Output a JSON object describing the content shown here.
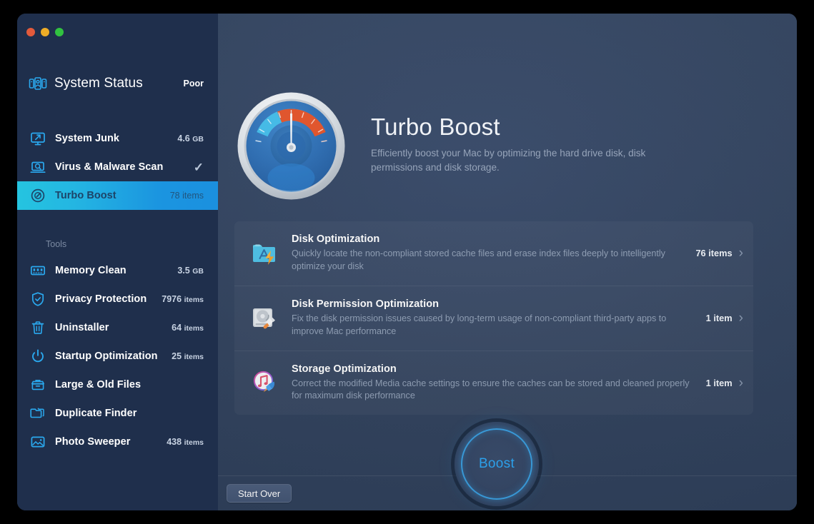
{
  "window": {
    "traffic_lights": [
      "close",
      "minimize",
      "zoom"
    ],
    "colors": {
      "sidebar_bg": "#1f2f4c",
      "main_bg": "#33445f",
      "accent_cyan": "#25c4e0",
      "accent_blue": "#1b90df",
      "boost_blue": "#2ea8f5",
      "muted_text": "#91a0b6"
    }
  },
  "sidebar": {
    "status": {
      "icon": "system-status-icon",
      "title": "System Status",
      "value": "Poor"
    },
    "main_items": [
      {
        "icon": "monitor-arrow-icon",
        "label": "System Junk",
        "value": "4.6",
        "unit": "GB",
        "value_type": "size",
        "active": false
      },
      {
        "icon": "laptop-search-icon",
        "label": "Virus & Malware Scan",
        "value": "",
        "unit": "",
        "value_type": "check",
        "active": false
      },
      {
        "icon": "speedometer-icon",
        "label": "Turbo Boost",
        "value": "78",
        "unit": "items",
        "value_type": "count",
        "active": true
      }
    ],
    "tools_header": "Tools",
    "tools": [
      {
        "icon": "memory-chip-icon",
        "label": "Memory Clean",
        "value": "3.5",
        "unit": "GB",
        "value_type": "size"
      },
      {
        "icon": "shield-check-icon",
        "label": "Privacy Protection",
        "value": "7976",
        "unit": "items",
        "value_type": "count"
      },
      {
        "icon": "trash-icon",
        "label": "Uninstaller",
        "value": "64",
        "unit": "items",
        "value_type": "count"
      },
      {
        "icon": "power-icon",
        "label": "Startup Optimization",
        "value": "25",
        "unit": "items",
        "value_type": "count"
      },
      {
        "icon": "archive-box-icon",
        "label": "Large & Old Files",
        "value": "",
        "unit": "",
        "value_type": "none"
      },
      {
        "icon": "copy-folder-icon",
        "label": "Duplicate Finder",
        "value": "",
        "unit": "",
        "value_type": "none"
      },
      {
        "icon": "photo-icon",
        "label": "Photo Sweeper",
        "value": "438",
        "unit": "items",
        "value_type": "count"
      }
    ]
  },
  "main": {
    "hero": {
      "icon": "turbo-boost-gauge-icon",
      "title": "Turbo Boost",
      "subtitle": "Efficiently boost your Mac by optimizing the hard drive disk, disk permissions and disk storage."
    },
    "rows": [
      {
        "icon": "app-folder-bolt-icon",
        "title": "Disk Optimization",
        "description": "Quickly locate the non-compliant stored cache files and erase index files deeply to intelligently optimize your disk",
        "count": "76 items",
        "chevron": "chevron-right-icon"
      },
      {
        "icon": "hard-drive-repair-icon",
        "title": "Disk Permission Optimization",
        "description": "Fix the disk permission issues caused by long-term usage of non-compliant third-party apps to improve Mac performance",
        "count": "1 item",
        "chevron": "chevron-right-icon"
      },
      {
        "icon": "itunes-rocket-icon",
        "title": "Storage Optimization",
        "description": "Correct the modified Media cache settings to ensure the caches can be stored and cleaned properly for maximum disk performance",
        "count": "1 item",
        "chevron": "chevron-right-icon"
      }
    ],
    "start_over_label": "Start Over",
    "boost_label": "Boost"
  }
}
